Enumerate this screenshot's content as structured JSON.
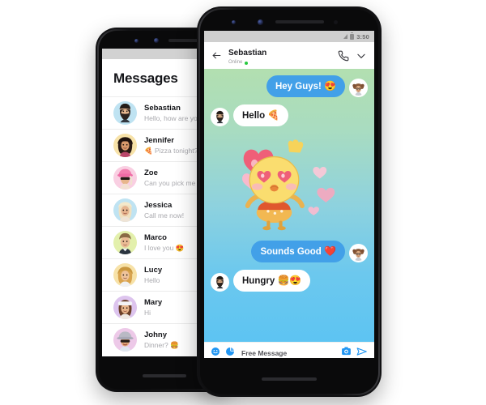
{
  "meta": {
    "scene": "two-android-phones-messaging-app-mockup",
    "accent_blue": "#42a0e8",
    "bubble_white": "#ffffff",
    "chat_gradient_top": "#b2dfb0",
    "chat_gradient_bottom": "#5dc4f2",
    "status_bar_grey": "#cfcfcf",
    "online_green": "#27c93f"
  },
  "left_phone": {
    "status_bar": {
      "time": "",
      "signal_icon": "signal-icon",
      "battery_icon": "battery-icon"
    },
    "header": {
      "title": "Messages"
    },
    "conversations": [
      {
        "name": "Sebastian",
        "preview": "Hello, how are you",
        "emoji": "",
        "avatar_bg": "#bfe3f2",
        "avatar_name": "avatar-sebastian"
      },
      {
        "name": "Jennifer",
        "preview": "Pizza tonight?",
        "emoji": "🍕",
        "emoji_position": "before",
        "avatar_bg": "#f7e2a8",
        "avatar_name": "avatar-jennifer"
      },
      {
        "name": "Zoe",
        "preview": "Can you pick me u",
        "emoji": "",
        "avatar_bg": "#f9cfe2",
        "avatar_name": "avatar-zoe"
      },
      {
        "name": "Jessica",
        "preview": "Call me now!",
        "emoji": "",
        "avatar_bg": "#bfe3f2",
        "avatar_name": "avatar-jessica"
      },
      {
        "name": "Marco",
        "preview": "I love you",
        "emoji": "😍",
        "emoji_position": "after",
        "avatar_bg": "#e3f0ac",
        "avatar_name": "avatar-marco"
      },
      {
        "name": "Lucy",
        "preview": "Hello",
        "emoji": "",
        "avatar_bg": "#f7e2a8",
        "avatar_name": "avatar-lucy"
      },
      {
        "name": "Mary",
        "preview": "Hi",
        "emoji": "",
        "avatar_bg": "#ddc4ee",
        "avatar_name": "avatar-mary"
      },
      {
        "name": "Johny",
        "preview": "Dinner?",
        "emoji": "🍔",
        "emoji_position": "after",
        "avatar_bg": "#edc9e8",
        "avatar_name": "avatar-johny"
      }
    ]
  },
  "right_phone": {
    "status_bar": {
      "time": "3:50",
      "signal_icon": "signal-icon",
      "battery_icon": "battery-icon"
    },
    "chat_header": {
      "back_icon": "back-arrow-icon",
      "contact_name": "Sebastian",
      "status_text": "Online",
      "call_icon": "phone-call-icon",
      "more_icon": "chevron-down-icon"
    },
    "messages": [
      {
        "id": "m1",
        "side": "right",
        "text": "Hey Guys!",
        "emoji": "😍",
        "bubble": "blue",
        "avatar_name": "avatar-girl-sender"
      },
      {
        "id": "m2",
        "side": "left",
        "text": "Hello",
        "emoji": "🍕",
        "bubble": "white",
        "avatar_name": "avatar-sebastian"
      },
      {
        "id": "m3",
        "side": "sticker",
        "sticker_name": "chick-in-love-sticker",
        "description": "yellow chick with heart eyes holding heart balloons"
      },
      {
        "id": "m4",
        "side": "right",
        "text": "Sounds Good",
        "emoji": "❤️",
        "bubble": "blue",
        "avatar_name": "avatar-girl-sender"
      },
      {
        "id": "m5",
        "side": "left",
        "text": "Hungry",
        "emoji": "🍔😍",
        "bubble": "white",
        "avatar_name": "avatar-sebastian"
      }
    ],
    "input_bar": {
      "emoji_icon": "smiley-face-icon",
      "sticker_icon": "sticker-icon",
      "placeholder": "Free Message",
      "camera_icon": "camera-icon",
      "send_icon": "send-arrow-icon"
    }
  }
}
